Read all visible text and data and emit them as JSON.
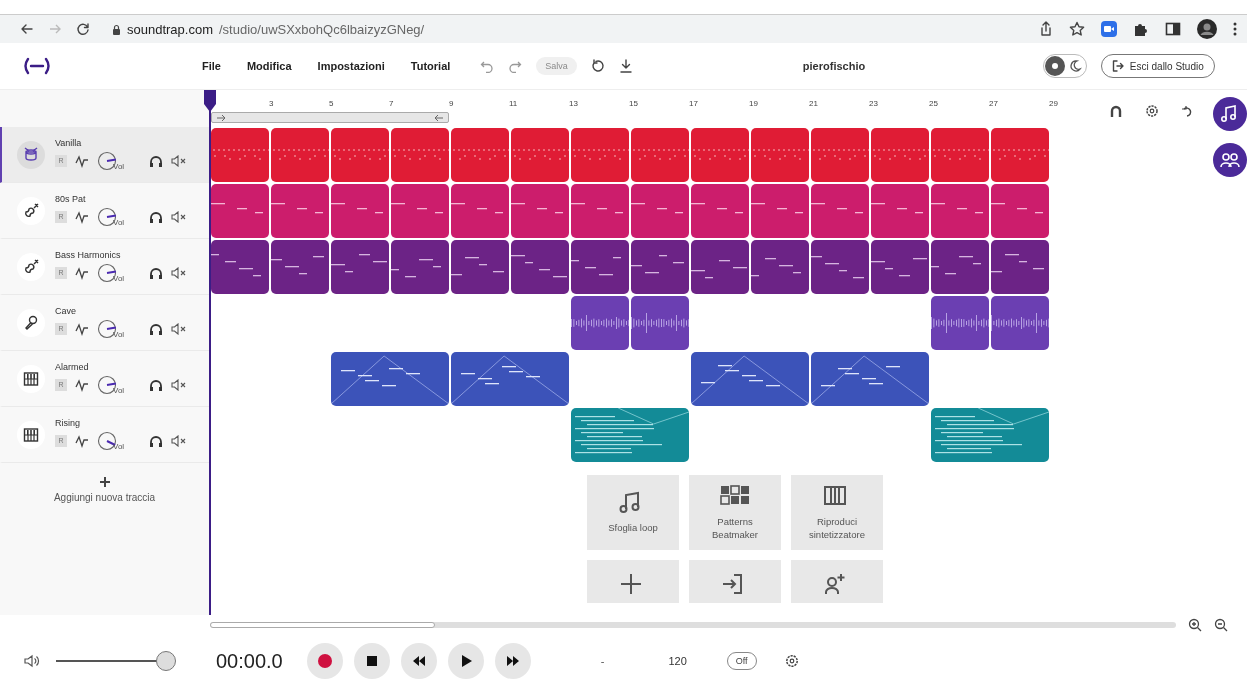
{
  "browser": {
    "url_host": "soundtrap.com",
    "url_path": "/studio/uwSXxbohQc6lbaizyzGNeg/"
  },
  "menu": [
    {
      "label": "File"
    },
    {
      "label": "Modifica"
    },
    {
      "label": "Impostazioni"
    },
    {
      "label": "Tutorial"
    }
  ],
  "save": {
    "label": "Salva",
    "disabled": true
  },
  "username": "pierofischio",
  "theme_toggle": {
    "dark": false
  },
  "exit_button": "Esci dallo Studio",
  "ruler": [
    "3",
    "5",
    "7",
    "9",
    "11",
    "13",
    "15",
    "17",
    "19",
    "21",
    "23",
    "25",
    "27",
    "29"
  ],
  "tracks": [
    {
      "name": "Vanilla",
      "kind": "drums",
      "selected": true,
      "record": "R",
      "vol_label": "Vol",
      "level": 0.8,
      "color": "#e01c35",
      "lane": [
        {
          "kind": "clip"
        },
        {
          "kind": "clip"
        },
        {
          "kind": "clip"
        },
        {
          "kind": "clip"
        },
        {
          "kind": "clip"
        },
        {
          "kind": "clip"
        },
        {
          "kind": "clip"
        },
        {
          "kind": "clip"
        },
        {
          "kind": "clip"
        },
        {
          "kind": "clip"
        },
        {
          "kind": "clip"
        },
        {
          "kind": "clip"
        },
        {
          "kind": "clip"
        },
        {
          "kind": "clip"
        }
      ]
    },
    {
      "name": "80s Pat",
      "kind": "lead",
      "selected": false,
      "record": "R",
      "vol_label": "Vol",
      "level": 0.8,
      "color": "#cc1d6c",
      "lane": [
        {
          "kind": "clip"
        },
        {
          "kind": "clip"
        },
        {
          "kind": "clip"
        },
        {
          "kind": "clip"
        },
        {
          "kind": "clip"
        },
        {
          "kind": "clip"
        },
        {
          "kind": "clip"
        },
        {
          "kind": "clip"
        },
        {
          "kind": "clip"
        },
        {
          "kind": "clip"
        },
        {
          "kind": "clip"
        },
        {
          "kind": "clip"
        },
        {
          "kind": "clip"
        },
        {
          "kind": "clip"
        }
      ]
    },
    {
      "name": "Bass Harmonics",
      "kind": "bass",
      "selected": false,
      "record": "R",
      "vol_label": "Vol",
      "level": 0.8,
      "color": "#6c2386",
      "lane": [
        {
          "kind": "clip"
        },
        {
          "kind": "clip"
        },
        {
          "kind": "clip"
        },
        {
          "kind": "clip"
        },
        {
          "kind": "clip"
        },
        {
          "kind": "clip"
        },
        {
          "kind": "clip"
        },
        {
          "kind": "clip"
        },
        {
          "kind": "clip"
        },
        {
          "kind": "clip"
        },
        {
          "kind": "clip"
        },
        {
          "kind": "clip"
        },
        {
          "kind": "clip"
        },
        {
          "kind": "clip"
        }
      ]
    },
    {
      "name": "Cave",
      "kind": "vocal",
      "selected": false,
      "record": "R",
      "vol_label": "Vol",
      "level": 0.8,
      "color": "#6b3fb2",
      "lane": [
        {
          "kind": "gap"
        },
        {
          "kind": "gap"
        },
        {
          "kind": "gap"
        },
        {
          "kind": "gap"
        },
        {
          "kind": "gap"
        },
        {
          "kind": "gap"
        },
        {
          "kind": "clip"
        },
        {
          "kind": "clip"
        },
        {
          "kind": "gap"
        },
        {
          "kind": "gap"
        },
        {
          "kind": "gap"
        },
        {
          "kind": "gap"
        },
        {
          "kind": "clip"
        },
        {
          "kind": "clip"
        }
      ]
    },
    {
      "name": "Alarmed",
      "kind": "synth",
      "selected": false,
      "record": "R",
      "vol_label": "Vol",
      "level": 0.8,
      "color": "#3c53b9",
      "lane": [
        {
          "kind": "gap"
        },
        {
          "kind": "gap"
        },
        {
          "kind": "wide"
        },
        {
          "kind": "wide"
        },
        {
          "kind": "gap"
        },
        {
          "kind": "gap"
        },
        {
          "kind": "wide"
        },
        {
          "kind": "wide"
        }
      ]
    },
    {
      "name": "Rising",
      "kind": "chords",
      "selected": false,
      "record": "R",
      "vol_label": "Vol",
      "level": 0.93,
      "color": "#138b97",
      "lane": [
        {
          "kind": "gap"
        },
        {
          "kind": "gap"
        },
        {
          "kind": "gap"
        },
        {
          "kind": "gap"
        },
        {
          "kind": "gap"
        },
        {
          "kind": "gap"
        },
        {
          "kind": "wide"
        },
        {
          "kind": "gap"
        },
        {
          "kind": "gap"
        },
        {
          "kind": "gap"
        },
        {
          "kind": "gap"
        },
        {
          "kind": "wide"
        }
      ]
    }
  ],
  "add_track": {
    "label": "Aggiungi nuova traccia"
  },
  "tiles": [
    {
      "kind": "loops",
      "label": "Sfoglia loop"
    },
    {
      "kind": "beatmaker",
      "label": "Patterns Beatmaker"
    },
    {
      "kind": "synth",
      "label": "Riproduci sintetizzatore"
    },
    {
      "kind": "new"
    },
    {
      "kind": "import"
    },
    {
      "kind": "invite"
    }
  ],
  "transport": {
    "volume": {
      "level": 1
    },
    "time": "00:00.0",
    "dash": "-",
    "tempo": "120",
    "metronome": "Off"
  }
}
